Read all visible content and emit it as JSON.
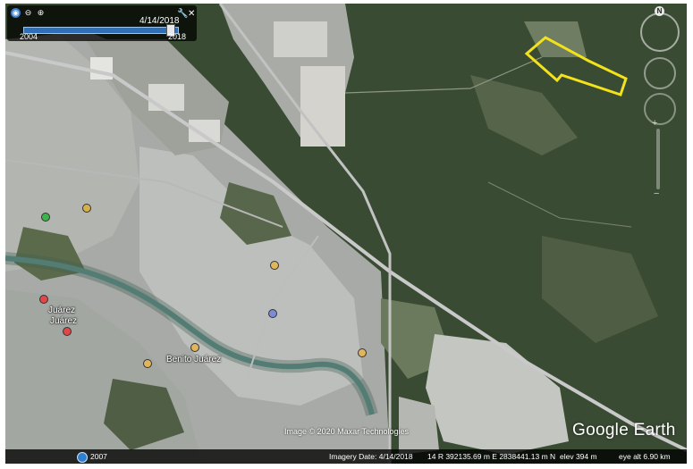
{
  "timeslider": {
    "current_date": "4/14/2018",
    "start_year": "2004",
    "end_year": "2018",
    "progress": 0.95,
    "icons": [
      "globe-icon",
      "zoom-out-icon",
      "zoom-in-icon",
      "wrench-icon",
      "close-icon"
    ]
  },
  "navigation": {
    "compass_label": "N"
  },
  "places": [
    {
      "name": "Juárez"
    },
    {
      "name": "Juárez"
    },
    {
      "name": "Benito Juárez"
    }
  ],
  "overlay": {
    "polygon_color": "#f2e21c"
  },
  "attribution": "Image © 2020 Maxar Technologies",
  "branding": "Google Earth",
  "statusbar": {
    "history_year": "2007",
    "imagery_date": "Imagery Date: 4/14/2018",
    "coordinates": "14 R 392135.69 m E 2838441.13 m N",
    "elevation": "elev  394 m",
    "eye_altitude": "eye alt  6.90 km"
  },
  "colors": {
    "urban": "#b7bab7",
    "vegetation": "#3d4f35",
    "river": "#5f8e86",
    "highway": "#c9c9c9",
    "statusbar": "#000000"
  }
}
